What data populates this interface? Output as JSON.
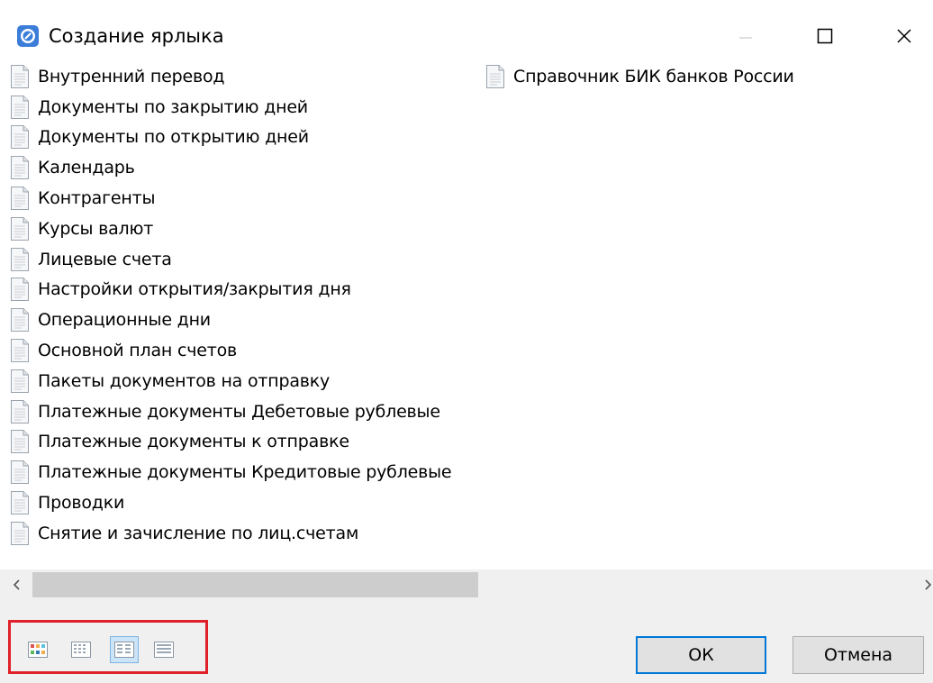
{
  "window": {
    "title": "Создание ярлыка",
    "minimize_glyph": "—",
    "close_glyph": "✕"
  },
  "list": {
    "column1": [
      {
        "label": "Внутренний перевод"
      },
      {
        "label": "Документы по закрытию дней"
      },
      {
        "label": "Документы по открытию дней"
      },
      {
        "label": "Календарь"
      },
      {
        "label": "Контрагенты"
      },
      {
        "label": "Курсы валют"
      },
      {
        "label": "Лицевые счета"
      },
      {
        "label": "Настройки открытия/закрытия дня"
      },
      {
        "label": "Операционные дни"
      },
      {
        "label": "Основной план счетов"
      },
      {
        "label": "Пакеты документов на отправку"
      },
      {
        "label": "Платежные документы Дебетовые рублевые"
      },
      {
        "label": "Платежные документы к отправке"
      },
      {
        "label": "Платежные документы Кредитовые рублевые"
      },
      {
        "label": "Проводки"
      },
      {
        "label": "Снятие и зачисление по лиц.счетам"
      }
    ],
    "column2": [
      {
        "label": "Справочник БИК банков России"
      }
    ]
  },
  "scrollbar": {
    "left_arrow": "‹",
    "position_fraction": 0.0
  },
  "view_modes": {
    "buttons": [
      {
        "icon": "large-icons-view-icon",
        "active": false
      },
      {
        "icon": "small-icons-view-icon",
        "active": false
      },
      {
        "icon": "list-view-icon",
        "active": true
      },
      {
        "icon": "details-view-icon",
        "active": false
      }
    ],
    "highlight_color": "#e0202a"
  },
  "buttons": {
    "ok_label": "ОК",
    "cancel_label": "Отмена"
  },
  "colors": {
    "accent": "#0078d7",
    "footer_bg": "#f0f0f0"
  }
}
